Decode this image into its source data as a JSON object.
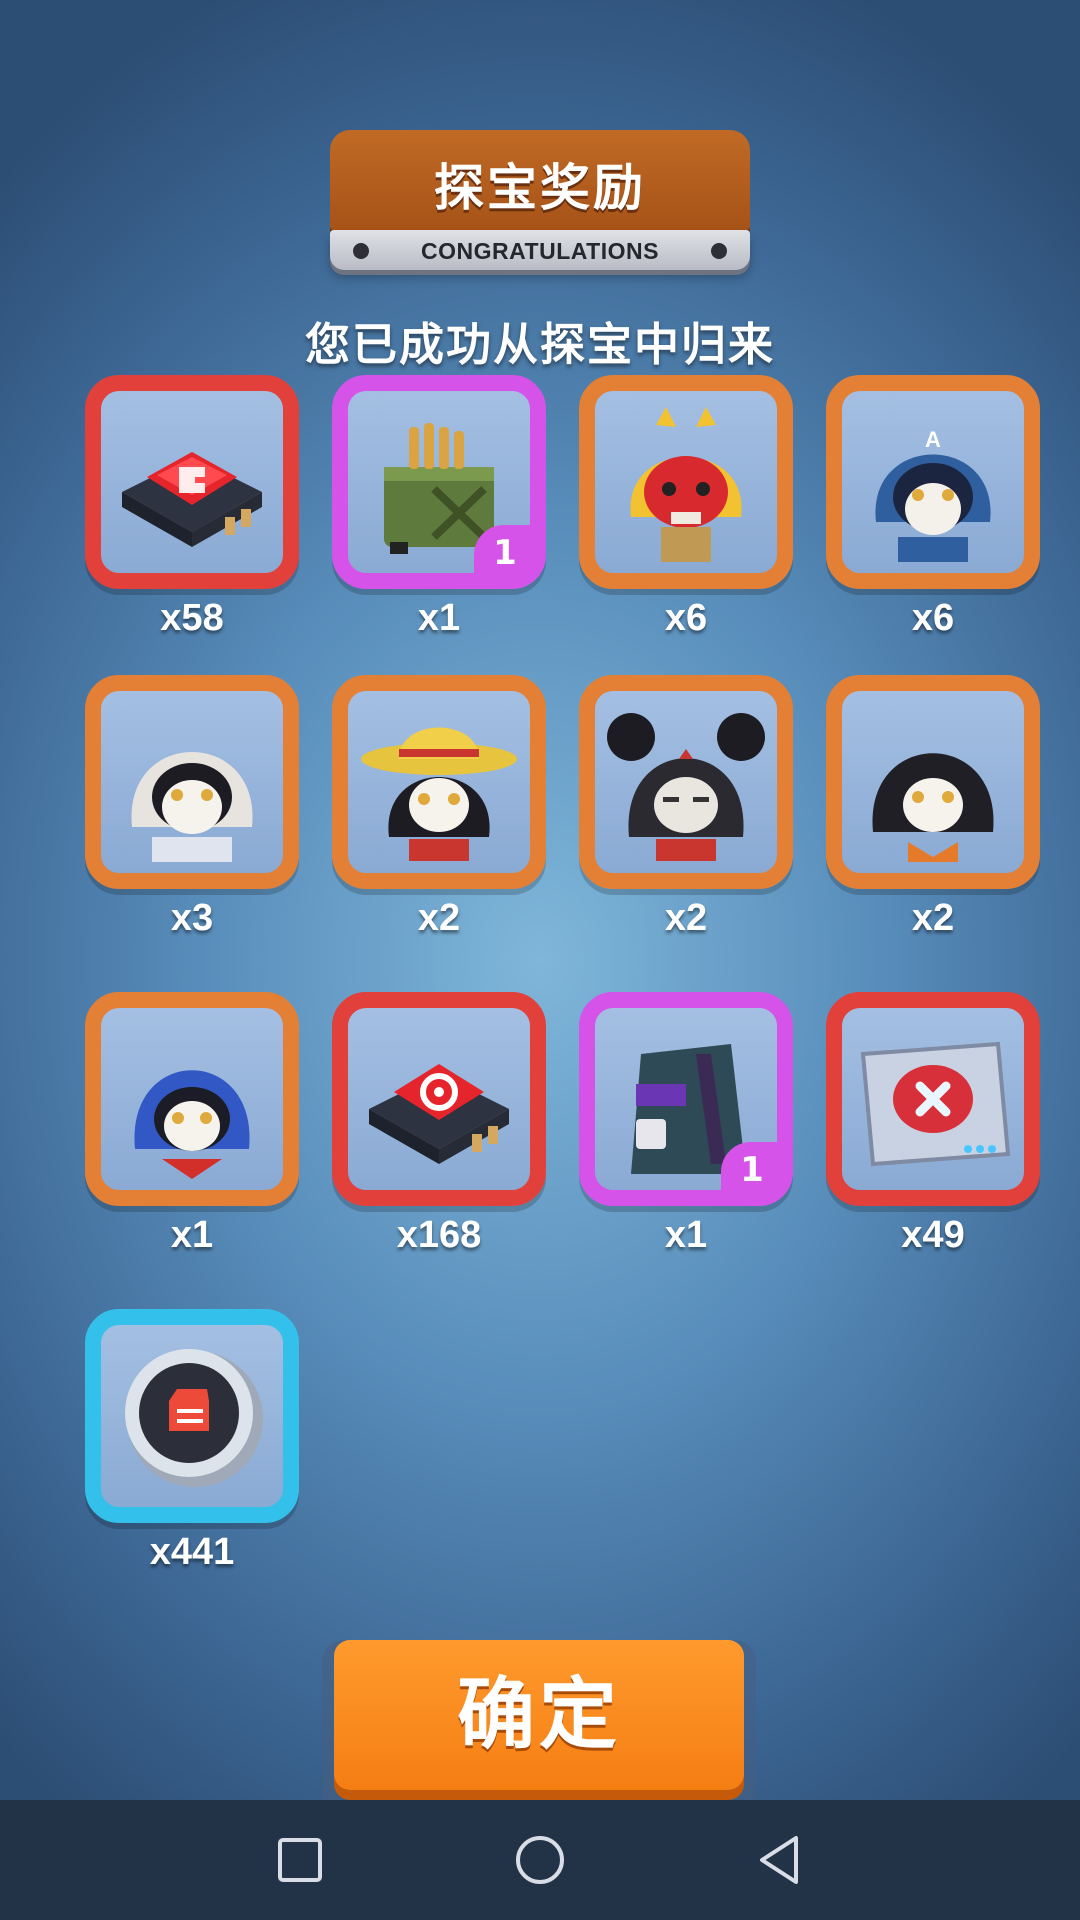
{
  "header": {
    "title": "探宝奖励",
    "subtitle_en": "CONGRATULATIONS"
  },
  "message": "您已成功从探宝中归来",
  "rewards": [
    {
      "icon": "red-chip-fist-icon",
      "quantity": "x58",
      "rarity": "red",
      "badge": ""
    },
    {
      "icon": "ammo-box-icon",
      "quantity": "x1",
      "rarity": "purple",
      "badge": "1"
    },
    {
      "icon": "yellow-hood-skull-icon",
      "quantity": "x6",
      "rarity": "orange",
      "badge": ""
    },
    {
      "icon": "captain-hood-skull-icon",
      "quantity": "x6",
      "rarity": "orange",
      "badge": ""
    },
    {
      "icon": "white-hood-skull-icon",
      "quantity": "x3",
      "rarity": "orange",
      "badge": ""
    },
    {
      "icon": "straw-hat-skull-icon",
      "quantity": "x2",
      "rarity": "orange",
      "badge": ""
    },
    {
      "icon": "mouse-ears-skull-icon",
      "quantity": "x2",
      "rarity": "orange",
      "badge": ""
    },
    {
      "icon": "black-hood-skull-icon",
      "quantity": "x2",
      "rarity": "orange",
      "badge": ""
    },
    {
      "icon": "blue-hood-skull-icon",
      "quantity": "x1",
      "rarity": "orange",
      "badge": ""
    },
    {
      "icon": "red-chip-gear-icon",
      "quantity": "x168",
      "rarity": "red",
      "badge": ""
    },
    {
      "icon": "armored-suit-icon",
      "quantity": "x1",
      "rarity": "purple",
      "badge": "1"
    },
    {
      "icon": "medkit-pad-icon",
      "quantity": "x49",
      "rarity": "red",
      "badge": ""
    },
    {
      "icon": "fist-coin-icon",
      "quantity": "x441",
      "rarity": "cyan",
      "badge": ""
    }
  ],
  "confirm_label": "确定",
  "navbar": {
    "icons": [
      "recent-apps-icon",
      "home-icon",
      "back-icon"
    ]
  },
  "colors": {
    "frame_orange": "#e38035",
    "frame_red": "#e2403a",
    "frame_purple": "#d653ea",
    "frame_cyan": "#33c0ea",
    "title_plaque": "#b55b1c",
    "confirm_button": "#f88a1e"
  }
}
